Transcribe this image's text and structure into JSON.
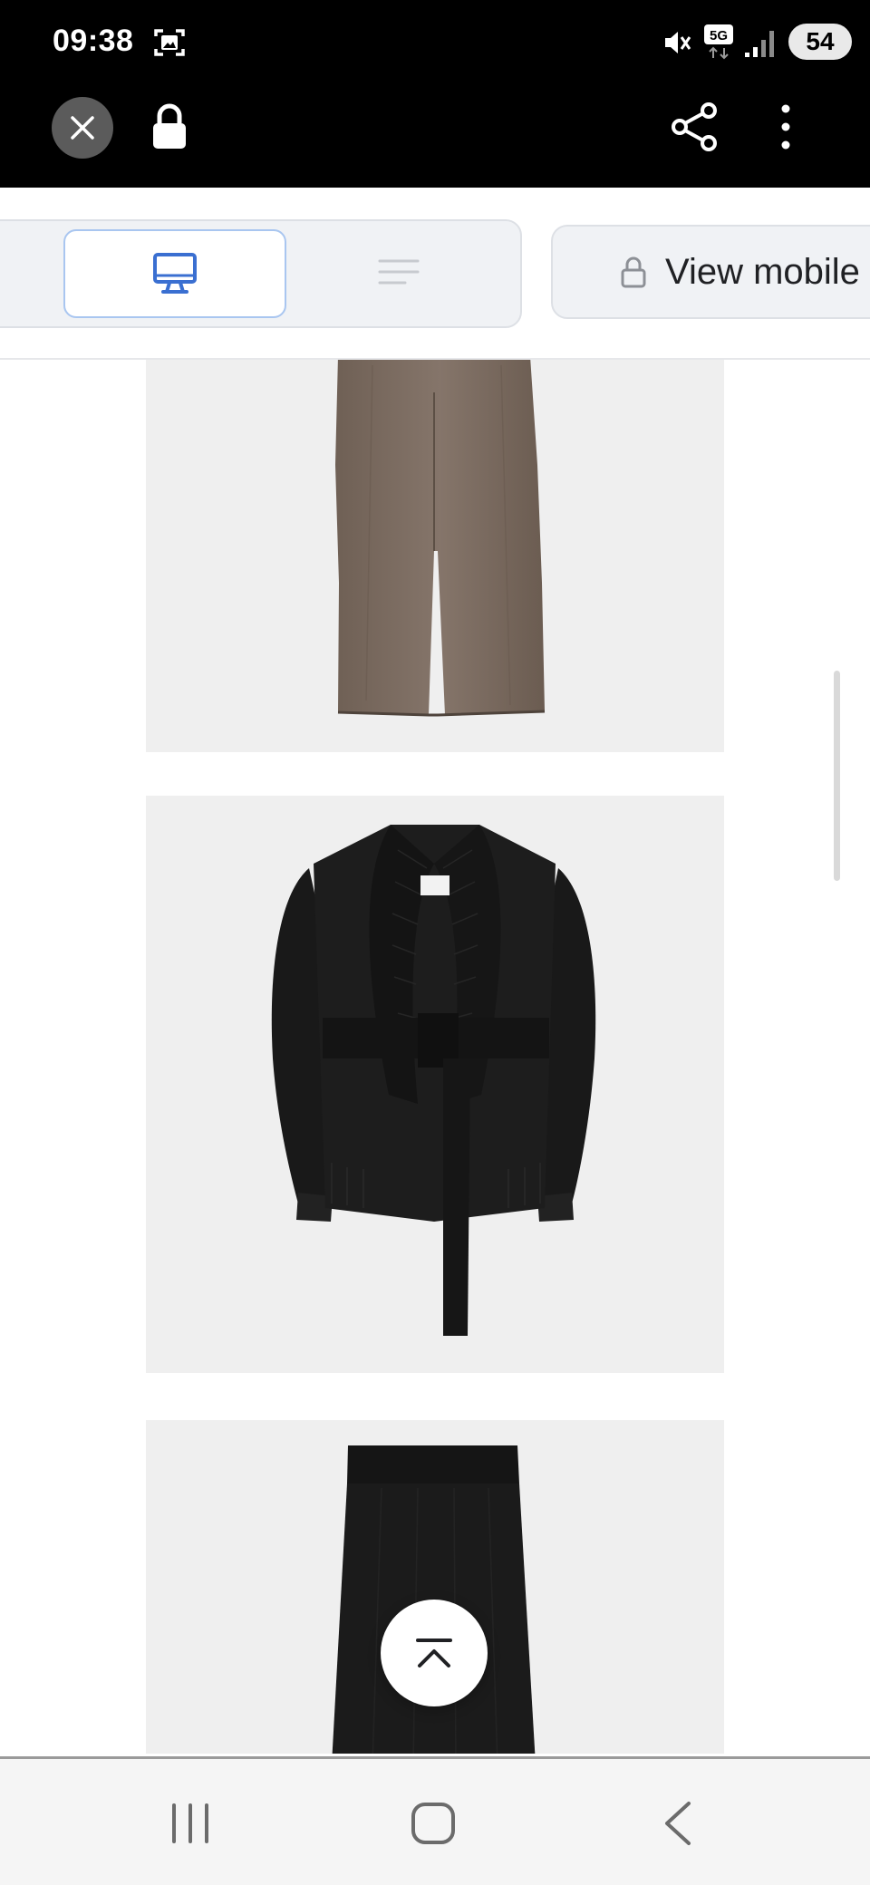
{
  "status_bar": {
    "time": "09:38",
    "battery": "54",
    "network": "5G",
    "icons": [
      "screenshot-icon",
      "mute-icon",
      "network-5g-icon",
      "signal-icon"
    ]
  },
  "browser": {
    "url": "ttps://milled.com/pierr",
    "icons": [
      "close-icon",
      "lock-icon",
      "share-icon",
      "more-vert-icon"
    ]
  },
  "toolbar": {
    "view_mobile_label": "View mobile",
    "icons": [
      "desktop-icon",
      "text-lines-icon",
      "lock-icon"
    ]
  },
  "products": [
    {
      "name": "brown knit wide-leg pants",
      "color": "#7a6a5e"
    },
    {
      "name": "black belted knit cardigan",
      "color": "#1c1c1c"
    },
    {
      "name": "black knit skirt",
      "color": "#1a1a1a"
    }
  ],
  "colors": {
    "card_background": "#efefef",
    "accent_blue": "#3a6fd1"
  },
  "nav_icons": [
    "recents-icon",
    "home-icon",
    "back-icon",
    "scroll-to-top-icon"
  ]
}
